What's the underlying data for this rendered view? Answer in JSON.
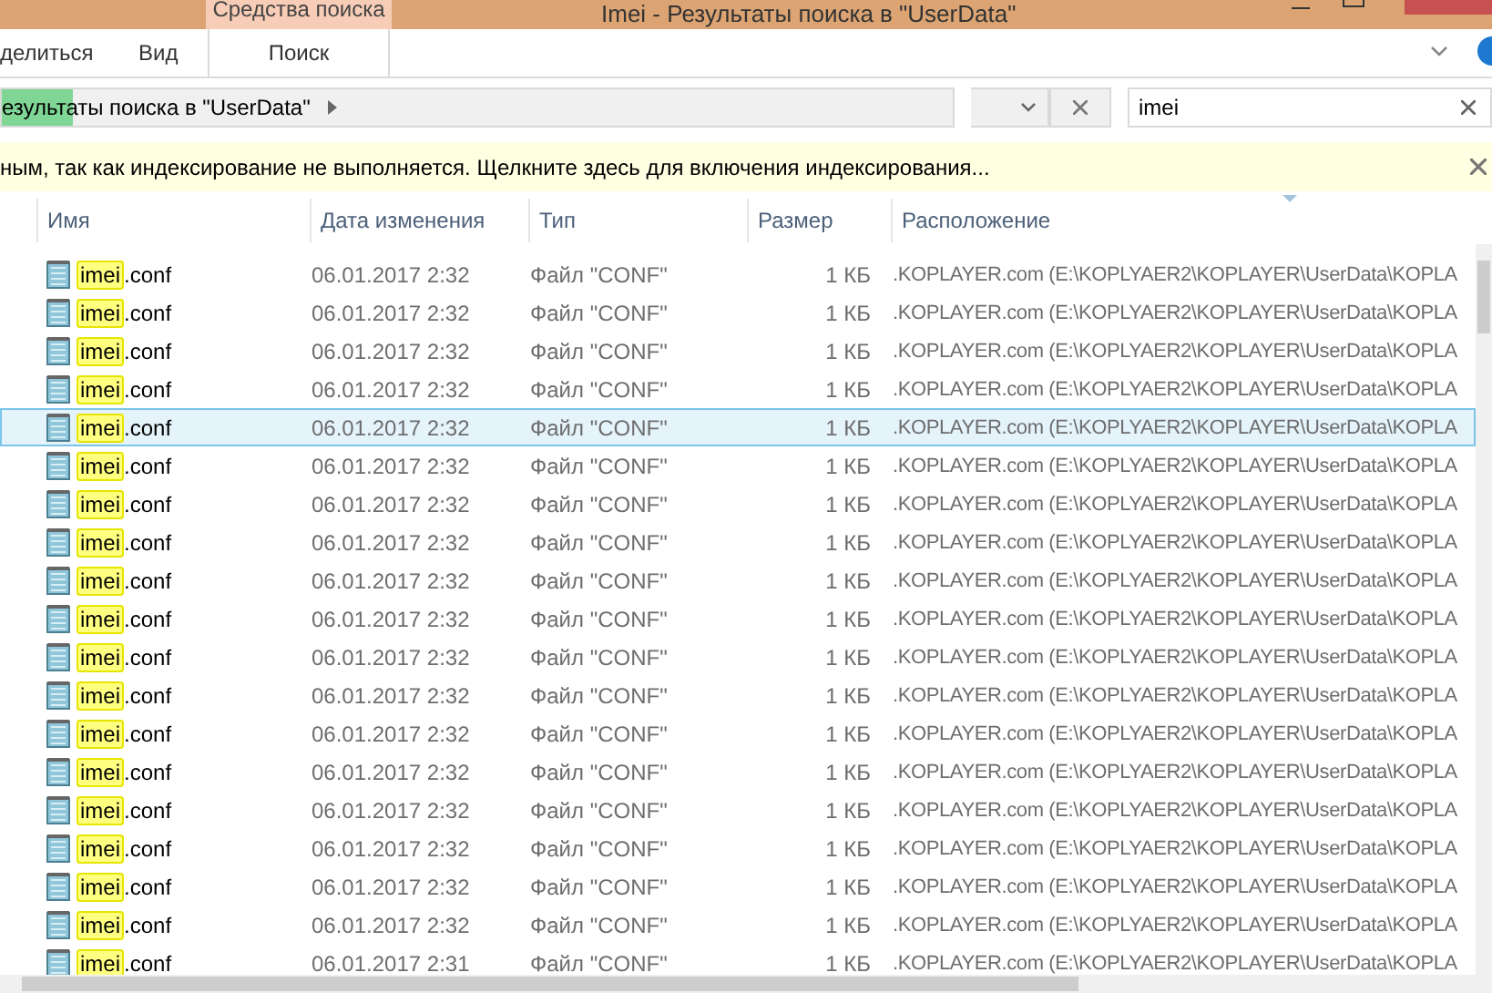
{
  "window": {
    "title": "Imei - Результаты поиска в \"UserData\"",
    "context_tab": "Средства поиска"
  },
  "ribbon_tabs": [
    {
      "label": "делиться",
      "selected": false
    },
    {
      "label": "Вид",
      "selected": false
    },
    {
      "label": "Поиск",
      "selected": true
    }
  ],
  "address_bar": {
    "path": "езультаты поиска в \"UserData\"",
    "level": 0.075
  },
  "search": {
    "value": "imei"
  },
  "info_bar": {
    "text": "ным, так как индексирование не выполняется. Щелкните здесь для включения индексирования..."
  },
  "table": {
    "columns": [
      "Имя",
      "Дата изменения",
      "Тип",
      "Размер",
      "Расположение"
    ],
    "rows": [
      {
        "name_match": "imei",
        "name_rest": ".conf",
        "date": "06.01.2017 2:32",
        "type": "Файл \"CONF\"",
        "size": "1 КБ",
        "location": ".KOPLAYER.com (E:\\KOPLYAER2\\KOPLAYER\\UserData\\KOPLA",
        "selected": false
      },
      {
        "name_match": "imei",
        "name_rest": ".conf",
        "date": "06.01.2017 2:32",
        "type": "Файл \"CONF\"",
        "size": "1 КБ",
        "location": ".KOPLAYER.com (E:\\KOPLYAER2\\KOPLAYER\\UserData\\KOPLA",
        "selected": false
      },
      {
        "name_match": "imei",
        "name_rest": ".conf",
        "date": "06.01.2017 2:32",
        "type": "Файл \"CONF\"",
        "size": "1 КБ",
        "location": ".KOPLAYER.com (E:\\KOPLYAER2\\KOPLAYER\\UserData\\KOPLA",
        "selected": false
      },
      {
        "name_match": "imei",
        "name_rest": ".conf",
        "date": "06.01.2017 2:32",
        "type": "Файл \"CONF\"",
        "size": "1 КБ",
        "location": ".KOPLAYER.com (E:\\KOPLYAER2\\KOPLAYER\\UserData\\KOPLA",
        "selected": false
      },
      {
        "name_match": "imei",
        "name_rest": ".conf",
        "date": "06.01.2017 2:32",
        "type": "Файл \"CONF\"",
        "size": "1 КБ",
        "location": ".KOPLAYER.com (E:\\KOPLYAER2\\KOPLAYER\\UserData\\KOPLA",
        "selected": true
      },
      {
        "name_match": "imei",
        "name_rest": ".conf",
        "date": "06.01.2017 2:32",
        "type": "Файл \"CONF\"",
        "size": "1 КБ",
        "location": ".KOPLAYER.com (E:\\KOPLYAER2\\KOPLAYER\\UserData\\KOPLA",
        "selected": false
      },
      {
        "name_match": "imei",
        "name_rest": ".conf",
        "date": "06.01.2017 2:32",
        "type": "Файл \"CONF\"",
        "size": "1 КБ",
        "location": ".KOPLAYER.com (E:\\KOPLYAER2\\KOPLAYER\\UserData\\KOPLA",
        "selected": false
      },
      {
        "name_match": "imei",
        "name_rest": ".conf",
        "date": "06.01.2017 2:32",
        "type": "Файл \"CONF\"",
        "size": "1 КБ",
        "location": ".KOPLAYER.com (E:\\KOPLYAER2\\KOPLAYER\\UserData\\KOPLA",
        "selected": false
      },
      {
        "name_match": "imei",
        "name_rest": ".conf",
        "date": "06.01.2017 2:32",
        "type": "Файл \"CONF\"",
        "size": "1 КБ",
        "location": ".KOPLAYER.com (E:\\KOPLYAER2\\KOPLAYER\\UserData\\KOPLA",
        "selected": false
      },
      {
        "name_match": "imei",
        "name_rest": ".conf",
        "date": "06.01.2017 2:32",
        "type": "Файл \"CONF\"",
        "size": "1 КБ",
        "location": ".KOPLAYER.com (E:\\KOPLYAER2\\KOPLAYER\\UserData\\KOPLA",
        "selected": false
      },
      {
        "name_match": "imei",
        "name_rest": ".conf",
        "date": "06.01.2017 2:32",
        "type": "Файл \"CONF\"",
        "size": "1 КБ",
        "location": ".KOPLAYER.com (E:\\KOPLYAER2\\KOPLAYER\\UserData\\KOPLA",
        "selected": false
      },
      {
        "name_match": "imei",
        "name_rest": ".conf",
        "date": "06.01.2017 2:32",
        "type": "Файл \"CONF\"",
        "size": "1 КБ",
        "location": ".KOPLAYER.com (E:\\KOPLYAER2\\KOPLAYER\\UserData\\KOPLA",
        "selected": false
      },
      {
        "name_match": "imei",
        "name_rest": ".conf",
        "date": "06.01.2017 2:32",
        "type": "Файл \"CONF\"",
        "size": "1 КБ",
        "location": ".KOPLAYER.com (E:\\KOPLYAER2\\KOPLAYER\\UserData\\KOPLA",
        "selected": false
      },
      {
        "name_match": "imei",
        "name_rest": ".conf",
        "date": "06.01.2017 2:32",
        "type": "Файл \"CONF\"",
        "size": "1 КБ",
        "location": ".KOPLAYER.com (E:\\KOPLYAER2\\KOPLAYER\\UserData\\KOPLA",
        "selected": false
      },
      {
        "name_match": "imei",
        "name_rest": ".conf",
        "date": "06.01.2017 2:32",
        "type": "Файл \"CONF\"",
        "size": "1 КБ",
        "location": ".KOPLAYER.com (E:\\KOPLYAER2\\KOPLAYER\\UserData\\KOPLA",
        "selected": false
      },
      {
        "name_match": "imei",
        "name_rest": ".conf",
        "date": "06.01.2017 2:32",
        "type": "Файл \"CONF\"",
        "size": "1 КБ",
        "location": ".KOPLAYER.com (E:\\KOPLYAER2\\KOPLAYER\\UserData\\KOPLA",
        "selected": false
      },
      {
        "name_match": "imei",
        "name_rest": ".conf",
        "date": "06.01.2017 2:32",
        "type": "Файл \"CONF\"",
        "size": "1 КБ",
        "location": ".KOPLAYER.com (E:\\KOPLYAER2\\KOPLAYER\\UserData\\KOPLA",
        "selected": false
      },
      {
        "name_match": "imei",
        "name_rest": ".conf",
        "date": "06.01.2017 2:32",
        "type": "Файл \"CONF\"",
        "size": "1 КБ",
        "location": ".KOPLAYER.com (E:\\KOPLYAER2\\KOPLAYER\\UserData\\KOPLA",
        "selected": false
      },
      {
        "name_match": "imei",
        "name_rest": ".conf",
        "date": "06.01.2017 2:31",
        "type": "Файл \"CONF\"",
        "size": "1 КБ",
        "location": ".KOPLAYER.com (E:\\KOPLYAER2\\KOPLAYER\\UserData\\KOPLA",
        "selected": false
      }
    ]
  }
}
